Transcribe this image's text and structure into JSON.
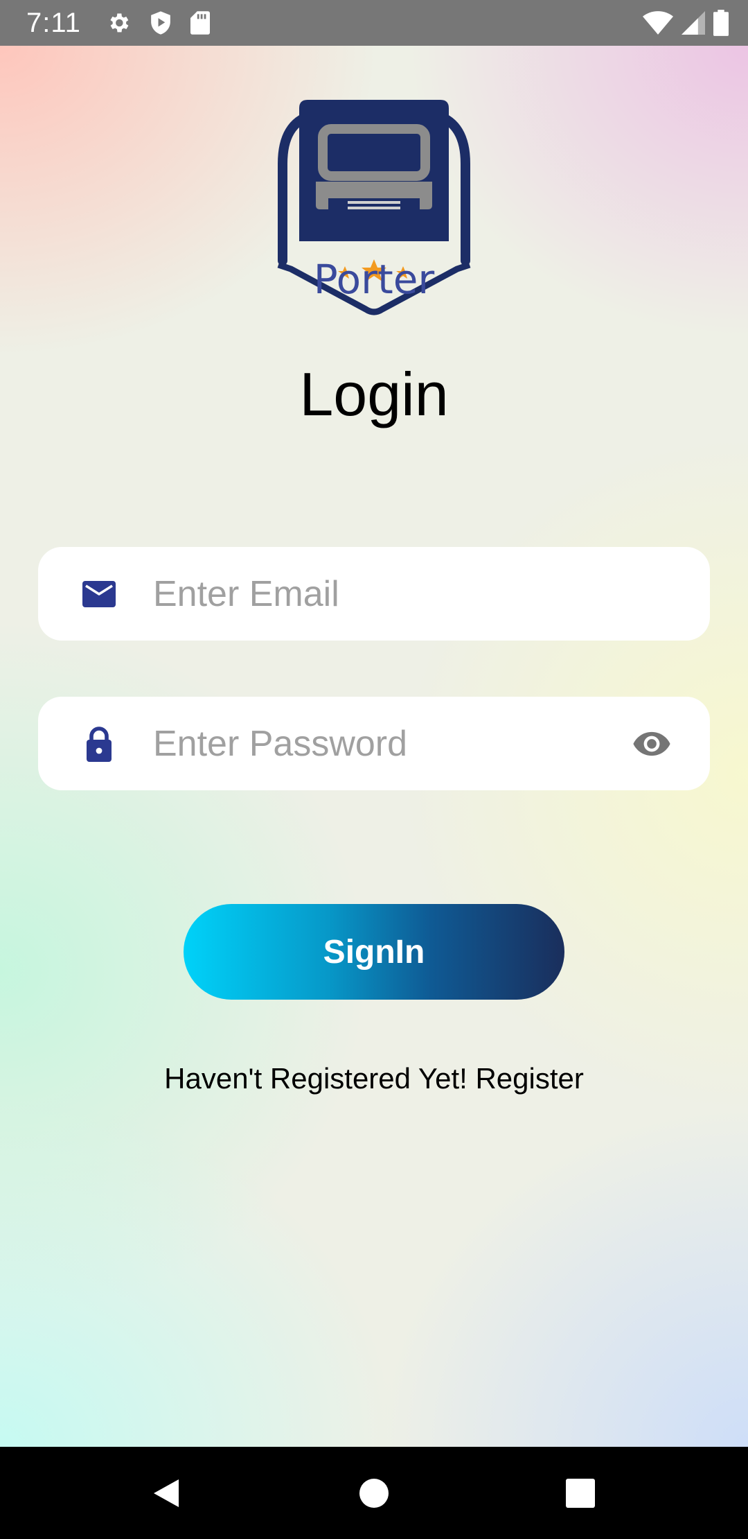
{
  "status_bar": {
    "time": "7:11",
    "left_icons": [
      "settings-icon",
      "shield-play-icon",
      "sd-card-icon"
    ],
    "right_icons": [
      "wifi-icon",
      "cell-signal-icon",
      "battery-icon"
    ]
  },
  "logo": {
    "brand_text": "Porter",
    "colors": {
      "navy": "#1c2d66",
      "gray": "#8c8c8c",
      "text_blue": "#3a4a9c",
      "star_orange": "#f39a1f"
    }
  },
  "login": {
    "title": "Login",
    "email": {
      "placeholder": "Enter Email",
      "value": "",
      "icon": "mail-icon"
    },
    "password": {
      "placeholder": "Enter Password",
      "value": "",
      "icon": "lock-icon",
      "toggle_icon": "eye-icon"
    },
    "signin_label": "SignIn",
    "register_text": "Haven't Registered Yet! Register"
  },
  "colors": {
    "icon_blue": "#2b3990",
    "button_gradient_start": "#00d2f9",
    "button_gradient_end": "#1a2e5c"
  },
  "nav_bar": {
    "buttons": [
      "back-icon",
      "home-icon",
      "recents-icon"
    ]
  }
}
